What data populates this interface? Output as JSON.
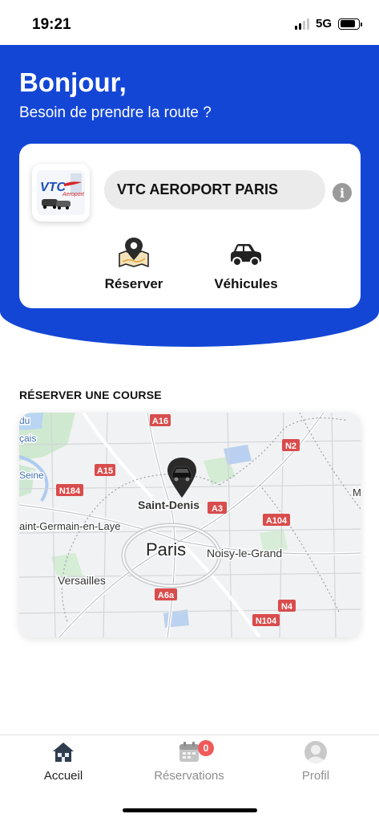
{
  "status_bar": {
    "time": "19:21",
    "network": "5G",
    "signal_bars": 2,
    "battery_level": 0.85
  },
  "header": {
    "greeting": "Bonjour,",
    "subtitle": "Besoin de prendre la route ?"
  },
  "agency": {
    "name": "VTC AEROPORT PARIS",
    "logo_text": "VTC",
    "logo_subtext": "Aeroport",
    "info_icon": "info-icon",
    "accent_color": "#1446d6"
  },
  "actions": [
    {
      "label": "Réserver",
      "icon": "map-pin-icon"
    },
    {
      "label": "Véhicules",
      "icon": "car-icon"
    }
  ],
  "section": {
    "title": "RÉSERVER UNE COURSE"
  },
  "map": {
    "city_label": "Paris",
    "place_labels": [
      "Saint-Denis",
      "Noisy-le-Grand",
      "Versailles",
      "aint-Germain-en-Laye",
      "du",
      "çais",
      "Seine",
      "M"
    ],
    "road_labels": [
      "A16",
      "N2",
      "A15",
      "N184",
      "A3",
      "A104",
      "A6a",
      "N4",
      "N104"
    ],
    "marker_icon": "car-location-marker-icon"
  },
  "tabbar": {
    "items": [
      {
        "label": "Accueil",
        "icon": "home-icon",
        "active": true
      },
      {
        "label": "Réservations",
        "icon": "calendar-icon",
        "active": false,
        "badge": "0"
      },
      {
        "label": "Profil",
        "icon": "user-avatar-icon",
        "active": false
      }
    ]
  }
}
